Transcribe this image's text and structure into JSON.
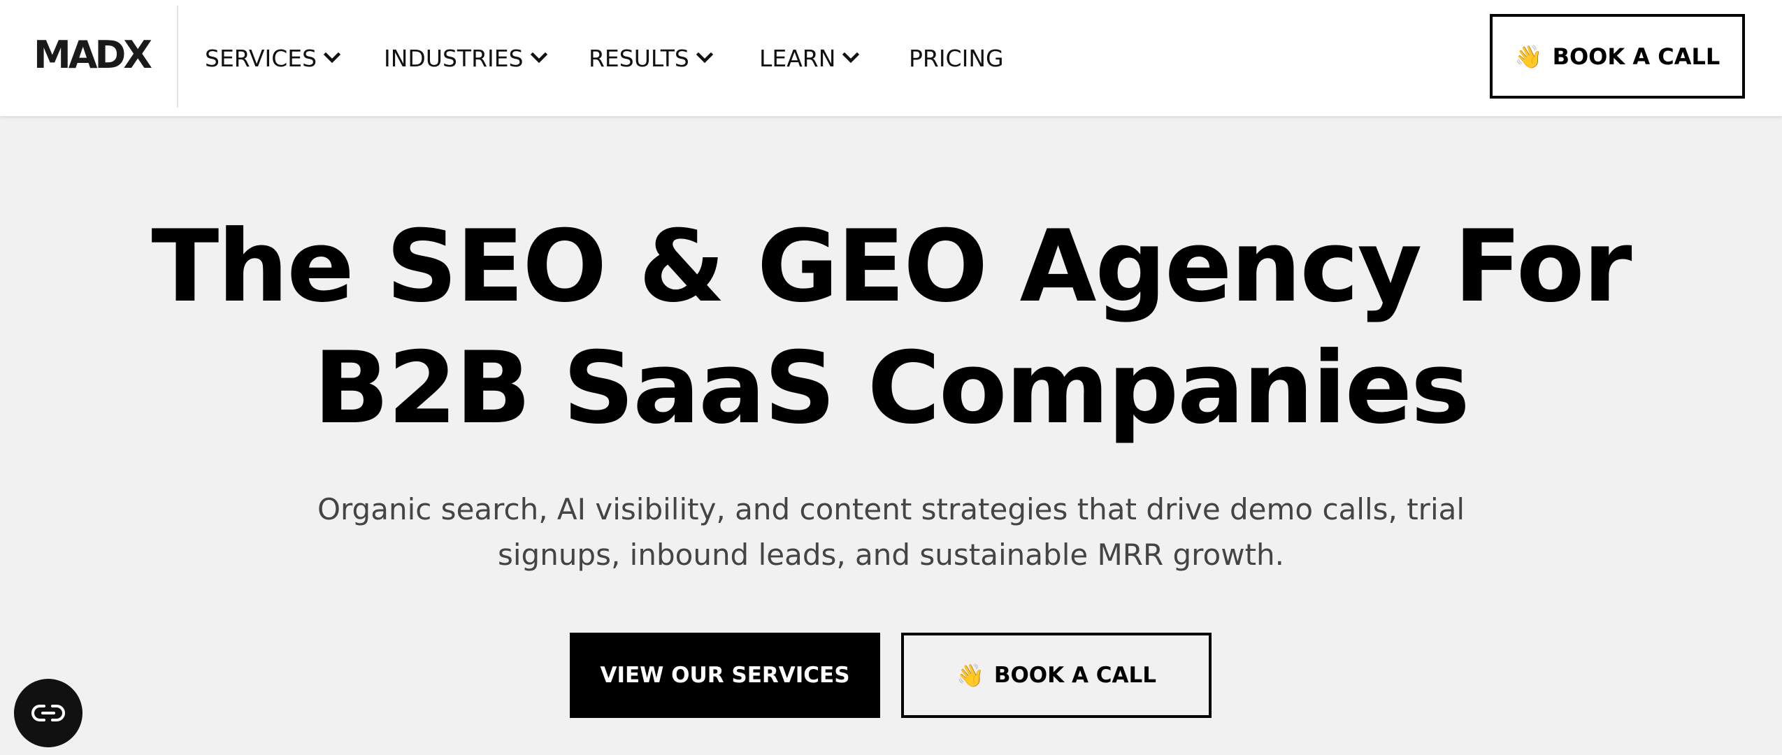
{
  "header": {
    "logo_text": "MADX",
    "nav": [
      {
        "label": "SERVICES",
        "has_dropdown": true,
        "icon": "chevron-down-icon"
      },
      {
        "label": "INDUSTRIES",
        "has_dropdown": true,
        "icon": "chevron-down-icon"
      },
      {
        "label": "RESULTS",
        "has_dropdown": true,
        "icon": "chevron-down-icon"
      },
      {
        "label": "LEARN",
        "has_dropdown": true,
        "icon": "chevron-down-icon"
      },
      {
        "label": "PRICING",
        "has_dropdown": false
      }
    ],
    "cta": {
      "emoji": "👋",
      "label": "BOOK A CALL"
    }
  },
  "hero": {
    "title_line1": "The SEO & GEO Agency For",
    "title_line2": "B2B SaaS Companies",
    "subtitle_line1": "Organic search, AI visibility, and content strategies that drive demo calls, trial",
    "subtitle_line2": "signups, inbound leads, and sustainable MRR growth.",
    "primary_button": "VIEW OUR SERVICES",
    "secondary_button": {
      "emoji": "👋",
      "label": "BOOK A CALL"
    }
  },
  "floating_widget": {
    "icon": "cookie-settings-icon"
  },
  "colors": {
    "background": "#f1f1f1",
    "header_bg": "#ffffff",
    "text": "#000000",
    "subtitle": "#444444",
    "primary_button_bg": "#000000",
    "primary_button_text": "#ffffff"
  }
}
